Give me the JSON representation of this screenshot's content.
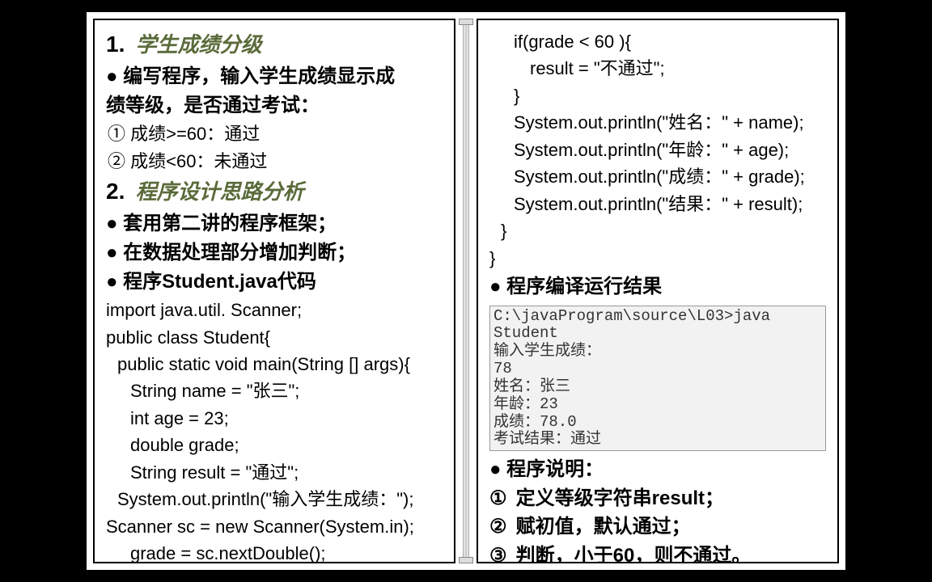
{
  "left": {
    "h1_num": "1.",
    "h1_text": "学生成绩分级",
    "bullet1_l1": "● 编写程序，输入学生成绩显示成",
    "bullet1_l2": "绩等级，是否通过考试：",
    "item1": "①   成绩>=60：通过",
    "item2": "②   成绩<60：未通过",
    "h2_num": "2.",
    "h2_text": "程序设计思路分析",
    "bullet2": "● 套用第二讲的程序框架；",
    "bullet3": "● 在数据处理部分增加判断；",
    "bullet4": "● 程序Student.java代码",
    "code1": "import java.util. Scanner;",
    "code2": "public class Student{",
    "code3": "public static void main(String [] args){",
    "code4": "String name = \"张三\";",
    "code5": "int age = 23;",
    "code6": "double grade;",
    "code7": "String result = \"通过\";",
    "code8": "System.out.println(\"输入学生成绩：\");",
    "code9": "Scanner sc = new Scanner(System.in);",
    "code10": "grade = sc.nextDouble();"
  },
  "right": {
    "code1": "if(grade < 60 ){",
    "code2": "result = \"不通过\";",
    "code3": "}",
    "code4": "System.out.println(\"姓名：\" + name);",
    "code5": "System.out.println(\"年龄：\" + age);",
    "code6": "System.out.println(\"成绩：\" + grade);",
    "code7": "System.out.println(\"结果：\" + result);",
    "code8": "}",
    "code9": "}",
    "bullet1": "● 程序编译运行结果",
    "out1": "C:\\javaProgram\\source\\L03>java Student",
    "out2": "输入学生成绩：",
    "out3": "78",
    "out4": "姓名：张三",
    "out5": "年龄：23",
    "out6": "成绩：78.0",
    "out7": "考试结果：通过",
    "bullet2": "● 程序说明：",
    "exp1_num": "①",
    "exp1": "定义等级字符串result；",
    "exp2_num": "②",
    "exp2": "赋初值，默认通过；",
    "exp3_num": "③",
    "exp3": "判断，小于60，则不通过。"
  }
}
